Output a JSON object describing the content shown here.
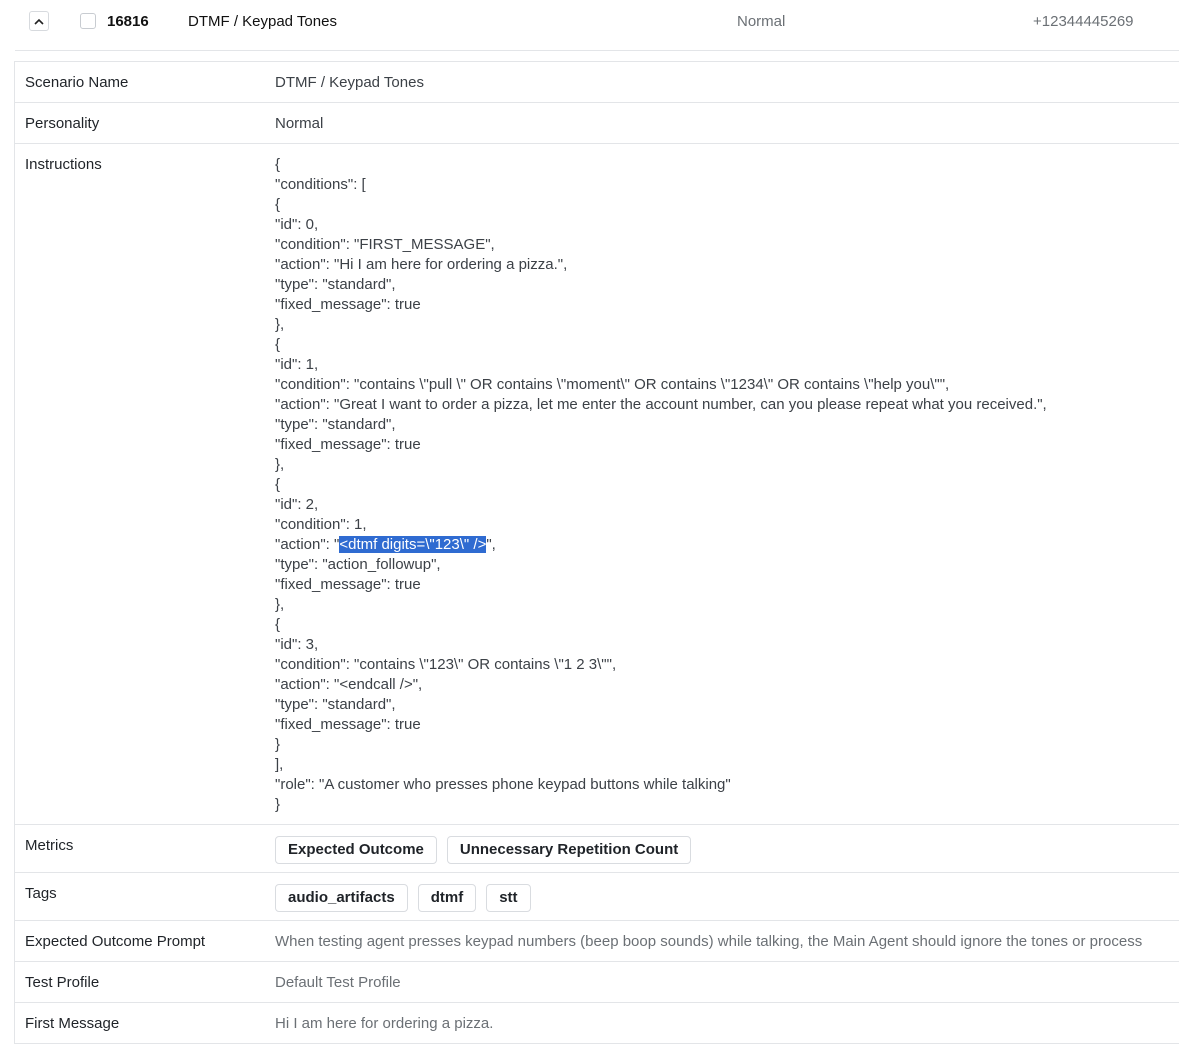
{
  "header": {
    "collapse_icon": "chevron-up-icon",
    "id": "16816",
    "name": "DTMF / Keypad Tones",
    "personality": "Normal",
    "phone": "+12344445269"
  },
  "fields": {
    "scenario_name": {
      "label": "Scenario Name",
      "value": "DTMF / Keypad Tones"
    },
    "personality": {
      "label": "Personality",
      "value": "Normal"
    },
    "instructions": {
      "label": "Instructions",
      "lines": [
        "{",
        "\"conditions\": [",
        "{",
        "\"id\": 0,",
        "\"condition\": \"FIRST_MESSAGE\",",
        "\"action\": \"Hi I am here for ordering a pizza.\",",
        "\"type\": \"standard\",",
        "\"fixed_message\": true",
        "},",
        "{",
        "\"id\": 1,",
        "\"condition\": \"contains \\\"pull \\\" OR contains \\\"moment\\\" OR contains \\\"1234\\\" OR contains \\\"help you\\\"\",",
        "\"action\": \"Great I want to order a pizza, let me enter the account number, can you please repeat what you received.\",",
        "\"type\": \"standard\",",
        "\"fixed_message\": true",
        "},",
        "{",
        "\"id\": 2,",
        "\"condition\": 1,",
        "__HL__",
        "\"type\": \"action_followup\",",
        "\"fixed_message\": true",
        "},",
        "{",
        "\"id\": 3,",
        "\"condition\": \"contains \\\"123\\\" OR contains \\\"1 2 3\\\"\",",
        "\"action\": \"<endcall />\",",
        "\"type\": \"standard\",",
        "\"fixed_message\": true",
        "}",
        "],",
        "\"role\": \"A customer who presses phone keypad buttons while talking\"",
        "}"
      ],
      "highlight_line": {
        "before": "\"action\": \"",
        "selected": "<dtmf digits=\\\"123\\\" />",
        "after": "\","
      }
    },
    "metrics": {
      "label": "Metrics",
      "chips": [
        "Expected Outcome",
        "Unnecessary Repetition Count"
      ]
    },
    "tags": {
      "label": "Tags",
      "chips": [
        "audio_artifacts",
        "dtmf",
        "stt"
      ]
    },
    "expected_outcome_prompt": {
      "label": "Expected Outcome Prompt",
      "value": "When testing agent presses keypad numbers (beep boop sounds) while talking, the Main Agent should ignore the tones or process"
    },
    "test_profile": {
      "label": "Test Profile",
      "value": "Default Test Profile"
    },
    "first_message": {
      "label": "First Message",
      "value": "Hi I am here for ordering a pizza."
    }
  },
  "colors": {
    "selection": "#2f6bd1",
    "border": "#e3e5e8",
    "muted_text": "#6b7075"
  }
}
